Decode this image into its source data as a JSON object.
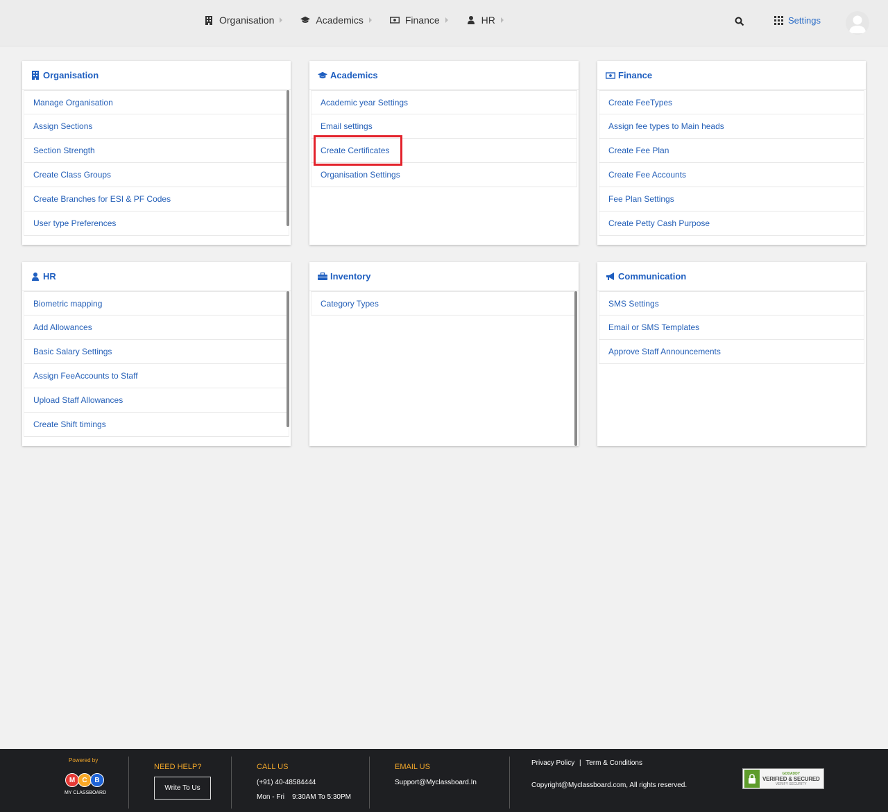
{
  "topnav": {
    "items": [
      {
        "label": "Organisation",
        "icon": "building-icon"
      },
      {
        "label": "Academics",
        "icon": "graduation-cap-icon"
      },
      {
        "label": "Finance",
        "icon": "money-icon"
      },
      {
        "label": "HR",
        "icon": "user-icon"
      }
    ],
    "settings_label": "Settings"
  },
  "cards": {
    "organisation": {
      "title": "Organisation",
      "items": [
        "Manage Organisation",
        "Assign Sections",
        "Section Strength",
        "Create Class Groups",
        "Create Branches for ESI & PF Codes",
        "User type Preferences"
      ]
    },
    "academics": {
      "title": "Academics",
      "items": [
        "Academic year Settings",
        "Email settings",
        "Create Certificates",
        "Organisation Settings"
      ]
    },
    "finance": {
      "title": "Finance",
      "items": [
        "Create FeeTypes",
        "Assign fee types to Main heads",
        "Create Fee Plan",
        "Create Fee Accounts",
        "Fee Plan Settings",
        "Create Petty Cash Purpose"
      ]
    },
    "hr": {
      "title": "HR",
      "items": [
        "Biometric mapping",
        "Add Allowances",
        "Basic Salary Settings",
        "Assign FeeAccounts to Staff",
        "Upload Staff Allowances",
        "Create Shift timings"
      ]
    },
    "inventory": {
      "title": "Inventory",
      "items": [
        "Category Types"
      ]
    },
    "communication": {
      "title": "Communication",
      "items": [
        "SMS Settings",
        "Email or SMS Templates",
        "Approve Staff Announcements"
      ]
    }
  },
  "footer": {
    "powered_by": "Powered by",
    "logo_letters": [
      "M",
      "C",
      "B"
    ],
    "logo_name": "MY CLASSBOARD",
    "need_help": "NEED HELP?",
    "write_to_us": "Write To Us",
    "call_us": "CALL US",
    "phone": "(+91) 40-48584444",
    "hours": "Mon - Fri    9:30AM To 5:30PM",
    "email_us": "EMAIL US",
    "email": "Support@Myclassboard.In",
    "privacy": "Privacy Policy",
    "link_sep": "|",
    "terms": "Term & Conditions",
    "copyright": "Copyright@Myclassboard.com, All rights reserved.",
    "badge": {
      "line1": "GODADDY",
      "line2": "VERIFIED & SECURED",
      "line3": "VERIFY SECURITY"
    }
  },
  "colors": {
    "link": "#2560b8",
    "header": "#1f5fc0",
    "highlight": "#e3232c",
    "footer_bg": "#1e1f22",
    "accent": "#f0a62a"
  }
}
